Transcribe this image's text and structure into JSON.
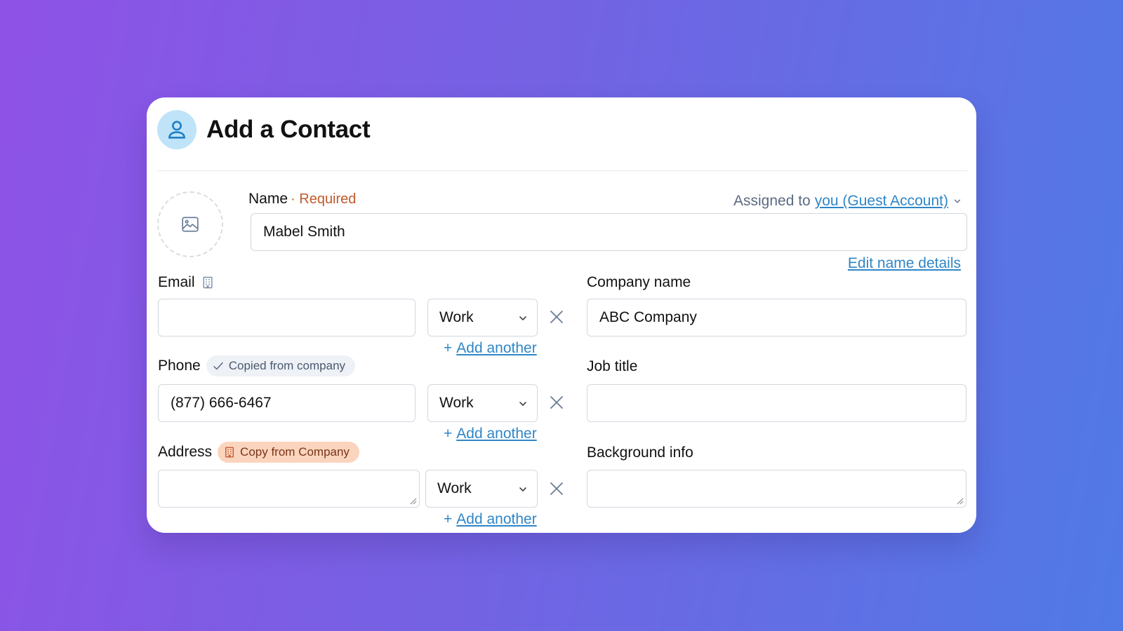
{
  "header": {
    "title": "Add a Contact",
    "icon": "user-icon"
  },
  "photo": {
    "icon": "image-icon"
  },
  "name": {
    "label": "Name",
    "required": "· Required",
    "value": "Mabel Smith",
    "assigned_prefix": "Assigned to",
    "assigned_user": "you (Guest Account)",
    "edit_link": "Edit name details"
  },
  "email": {
    "label": "Email",
    "value": "",
    "type": "Work",
    "add_another": "Add another",
    "add_plus": "+"
  },
  "phone": {
    "label": "Phone",
    "badge": "Copied from company",
    "value": "(877) 666-6467",
    "type": "Work",
    "add_another": "Add another",
    "add_plus": "+"
  },
  "address": {
    "label": "Address",
    "badge": "Copy from Company",
    "value": "",
    "type": "Work",
    "add_another": "Add another",
    "add_plus": "+"
  },
  "company": {
    "label": "Company name",
    "value": "ABC Company"
  },
  "job_title": {
    "label": "Job title",
    "value": ""
  },
  "background": {
    "label": "Background info",
    "value": ""
  },
  "colors": {
    "accent_link": "#2f86c7",
    "required": "#c05a2a",
    "badge_orange": "#fbd4bd",
    "header_icon_bg": "#bfe3f8"
  }
}
